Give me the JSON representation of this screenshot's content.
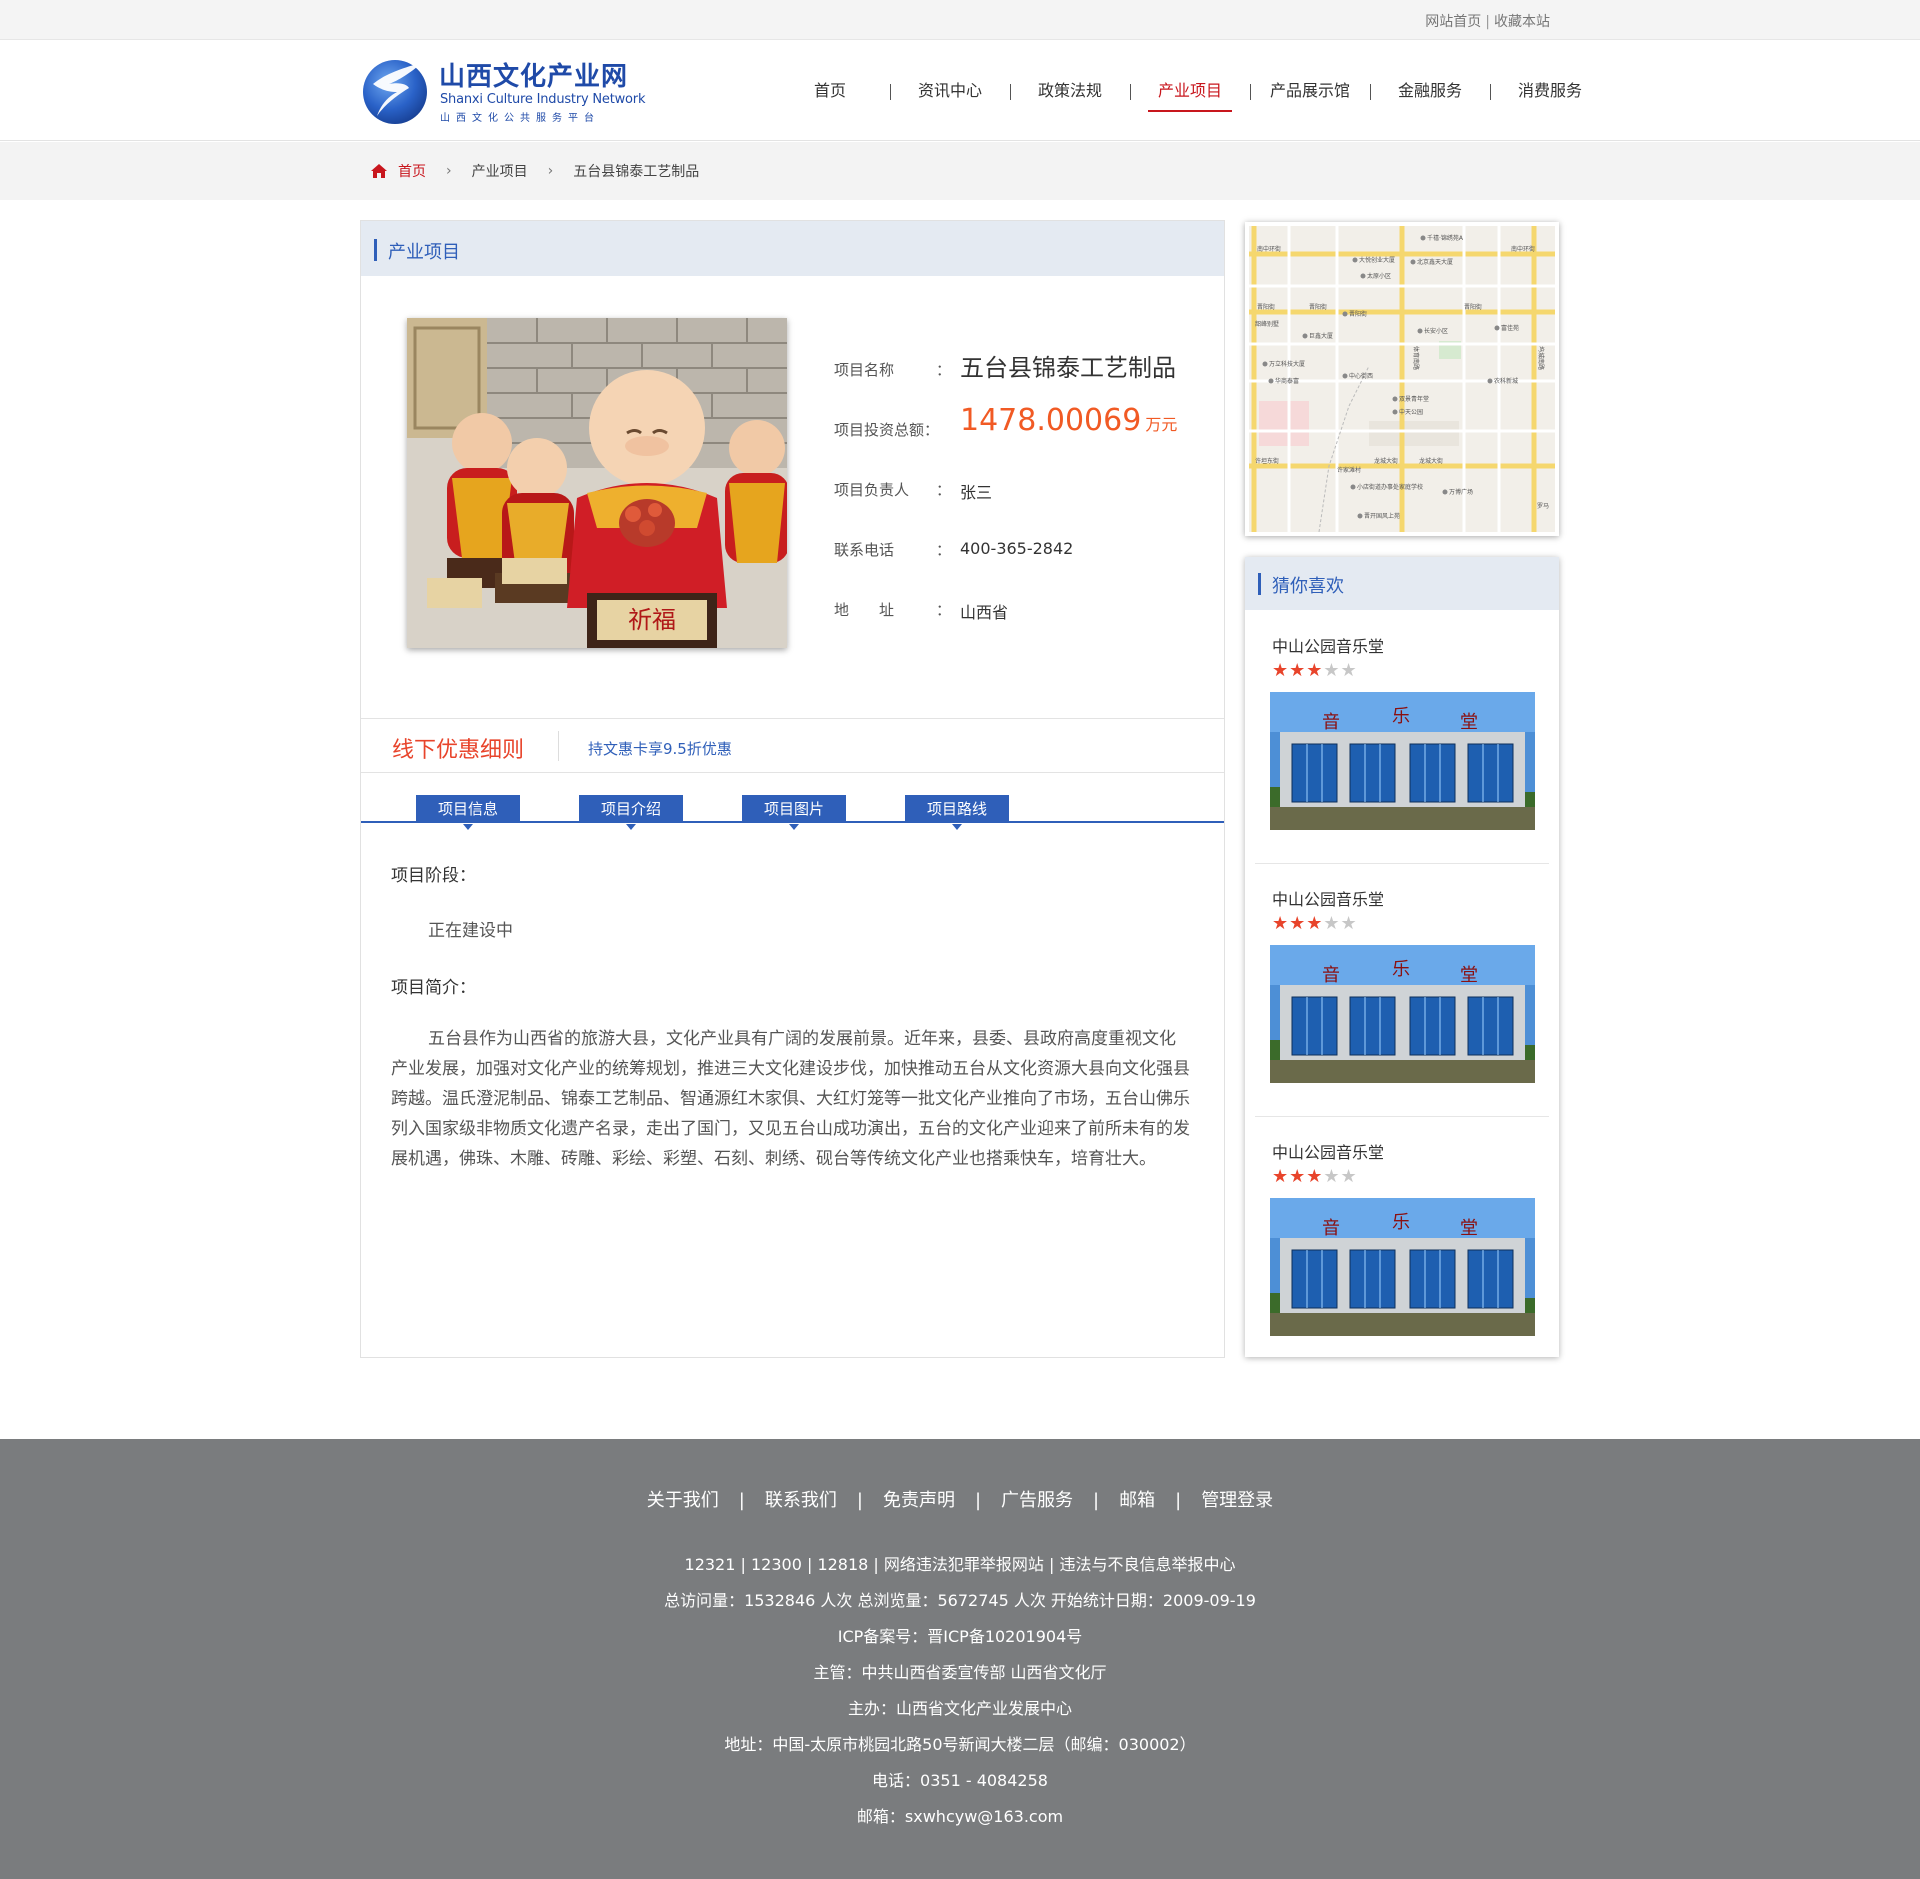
{
  "toplinks": {
    "home": "网站首页",
    "favorite": "收藏本站"
  },
  "logo": {
    "cn": "山西文化产业网",
    "en": "Shanxi Culture Industry Network",
    "sub": "山西文化公共服务平台"
  },
  "nav": [
    "首页",
    "资讯中心",
    "政策法规",
    "产业项目",
    "产品展示馆",
    "金融服务",
    "消费服务"
  ],
  "nav_active": "产业项目",
  "breadcrumb": {
    "home": "首页",
    "level1": "产业项目",
    "current": "五台县锦泰工艺制品"
  },
  "panel": {
    "title": "产业项目"
  },
  "project": {
    "name_label": "项目名称",
    "name": "五台县锦泰工艺制品",
    "invest_label": "项目投资总额：",
    "invest": "1478.00069",
    "invest_unit": "万元",
    "owner_label": "项目负责人",
    "owner": "张三",
    "phone_label": "联系电话",
    "phone": "400-365-2842",
    "addr_label": "地　　址",
    "addr": "山西省",
    "colon": "："
  },
  "offer": {
    "title": "线下优惠细则",
    "text": "持文惠卡享9.5折优惠"
  },
  "tabs": [
    "项目信息",
    "项目介绍",
    "项目图片",
    "项目路线"
  ],
  "content": {
    "stage_label": "项目阶段：",
    "stage": "正在建设中",
    "intro_label": "项目简介：",
    "intro": "五台县作为山西省的旅游大县，文化产业具有广阔的发展前景。近年来，县委、县政府高度重视文化产业发展，加强对文化产业的统筹规划，推进三大文化建设步伐，加快推动五台从文化资源大县向文化强县跨越。温氏澄泥制品、锦泰工艺制品、智通源红木家俱、大红灯笼等一批文化产业推向了市场，五台山佛乐列入国家级非物质文化遗产名录，走出了国门，又见五台山成功演出，五台的文化产业迎来了前所未有的发展机遇，佛珠、木雕、砖雕、彩绘、彩塑、石刻、刺绣、砚台等传统文化产业也搭乘快车，培育壮大。"
  },
  "map": {
    "streets": [
      "南中环街",
      "晋阳街",
      "龙城大街",
      "许坦东街",
      "体育南路",
      "坞城南路"
    ],
    "places": [
      "千禧·锦绣苑A",
      "大悦创业大厦",
      "太原小区",
      "北京鑫天大厦",
      "晋阳街",
      "长安小区",
      "富佳苑",
      "韶峰别墅",
      "巨鑫大厦",
      "中心街西",
      "万立科技大厦",
      "华商泰富",
      "农科新城",
      "双景青年堂",
      "中天公园",
      "龙城大街",
      "许家滩村",
      "小店街道办事处家庭学校",
      "万博广场",
      "晋开国风上苑",
      "罗马"
    ]
  },
  "like": {
    "title": "猜你喜欢",
    "items": [
      {
        "name": "中山公园音乐堂",
        "rating": 3,
        "max": 5
      },
      {
        "name": "中山公园音乐堂",
        "rating": 3,
        "max": 5
      },
      {
        "name": "中山公园音乐堂",
        "rating": 3,
        "max": 5
      }
    ],
    "pic_text": "音乐堂"
  },
  "footer": {
    "links": [
      "关于我们",
      "联系我们",
      "免责声明",
      "广告服务",
      "邮箱",
      "管理登录"
    ],
    "lines": [
      "12321 | 12300 | 12818 | 网络违法犯罪举报网站 | 违法与不良信息举报中心",
      "总访问量：1532846 人次  总浏览量：5672745 人次  开始统计日期：2009-09-19",
      "ICP备案号：晋ICP备10201904号",
      "主管：中共山西省委宣传部 山西省文化厅",
      "主办：山西省文化产业发展中心",
      "地址：中国-太原市桃园北路50号新闻大楼二层（邮编：030002）",
      "电话：0351 - 4084258",
      "邮箱：sxwhcyw@163.com"
    ]
  },
  "colors": {
    "brand_blue": "#2f5fb9",
    "accent_red": "#c8161d",
    "orange": "#f15a24",
    "footer_bg": "#7a7c7e"
  }
}
